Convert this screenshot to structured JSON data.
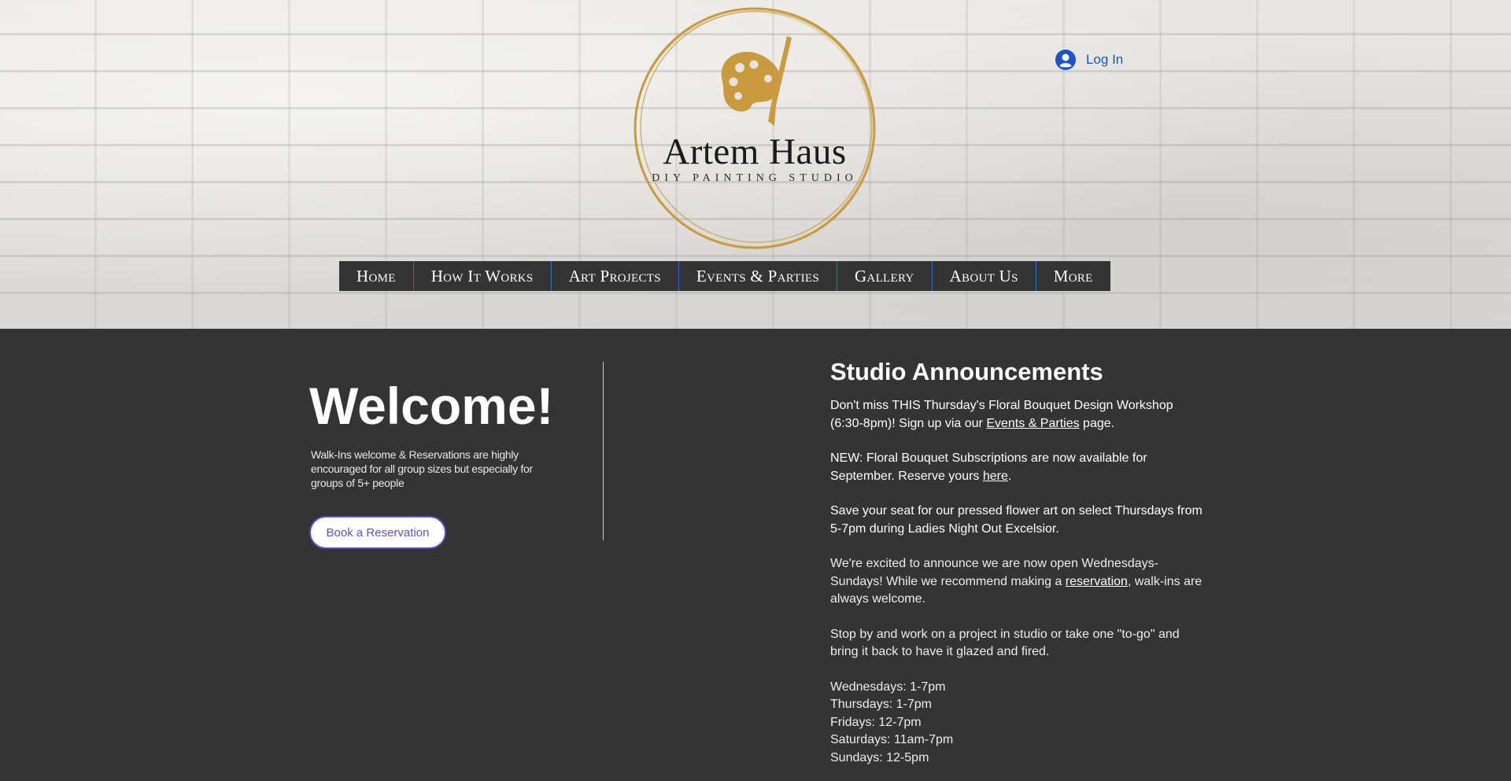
{
  "header": {
    "logo": {
      "title": "Artem Haus",
      "subtitle": "DIY PAINTING STUDIO",
      "accent_color": "#c99a3e"
    },
    "login": {
      "icon": "user-avatar-icon",
      "label": "Log In",
      "color": "#1a55c8"
    },
    "nav": {
      "items": [
        {
          "label": "Home"
        },
        {
          "label": "How It Works"
        },
        {
          "label": "Art Projects"
        },
        {
          "label": "Events & Parties"
        },
        {
          "label": "Gallery"
        },
        {
          "label": "About Us"
        },
        {
          "label": "More"
        }
      ]
    }
  },
  "welcome": {
    "title": "Welcome!",
    "text": "Walk-Ins welcome & Reservations are highly encouraged for all group sizes but especially for groups of 5+ people",
    "button_label": "Book a Reservation"
  },
  "announcements": {
    "title": "Studio Announcements",
    "p1": {
      "before": "Don't miss THIS Thursday's Floral Bouquet Design Workshop (6:30-8pm)! Sign up via our ",
      "link": "Events & Parties",
      "after": " page."
    },
    "p2": {
      "before": "NEW: Floral Bouquet Subscriptions are now available for September. Reserve yours ",
      "link": "here",
      "after": "."
    },
    "p3": "Save your seat for our pressed flower art on select Thursdays from 5-7pm during Ladies Night Out Excelsior.",
    "p4": {
      "before": "We're excited to announce we are now open Wednesdays-Sundays! While we recommend making a ",
      "link": "reservation",
      "after": ", walk-ins are always welcome."
    },
    "p5": "Stop by and work on a project in studio or take one \"to-go\" and bring it back to have it glazed and fired.",
    "hours": [
      "Wednesdays: 1-7pm",
      "Thursdays: 1-7pm",
      "Fridays: 12-7pm",
      "Saturdays: 11am-7pm",
      "Sundays: 12-5pm"
    ]
  }
}
